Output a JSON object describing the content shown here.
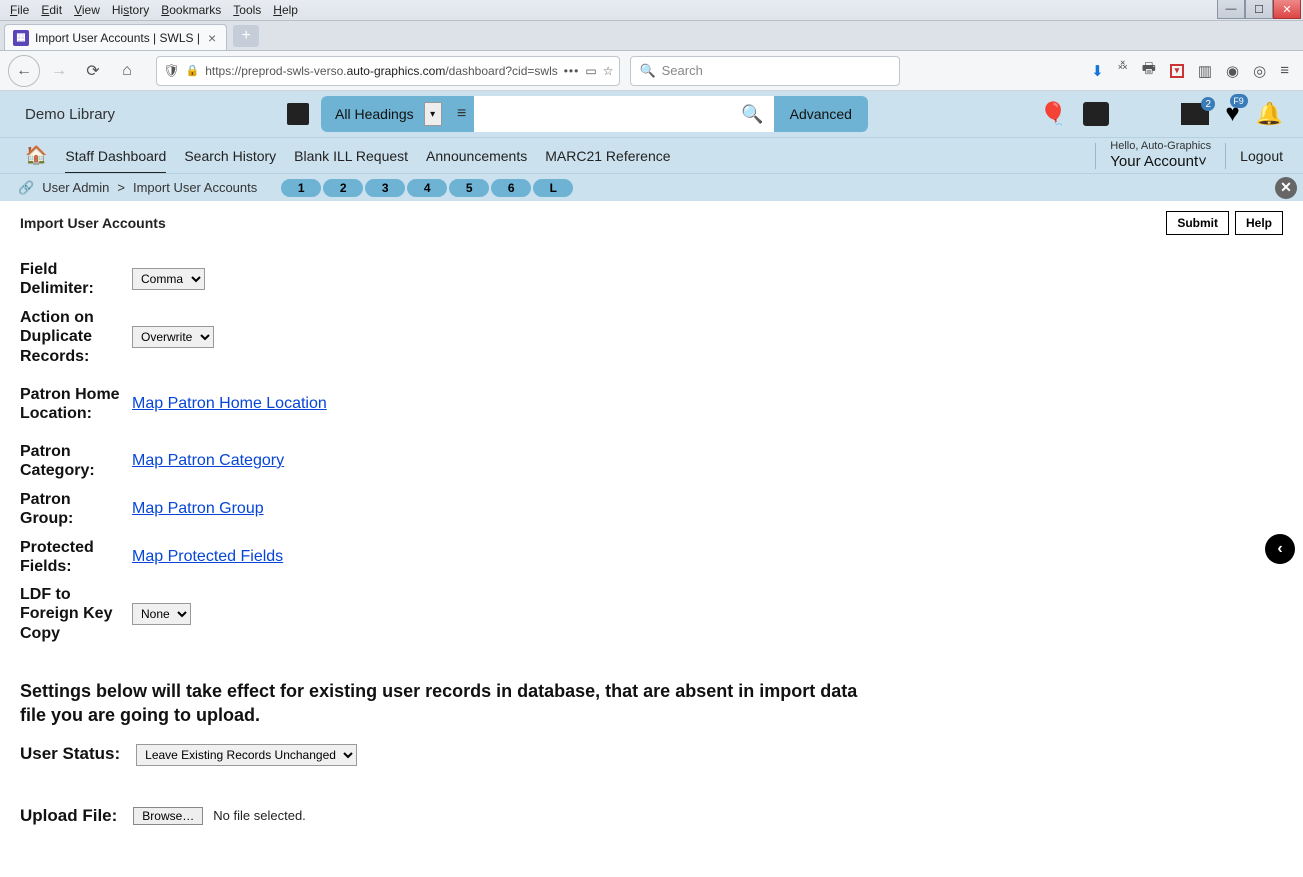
{
  "browser": {
    "menus": [
      "File",
      "Edit",
      "View",
      "History",
      "Bookmarks",
      "Tools",
      "Help"
    ],
    "tab_title": "Import User Accounts | SWLS | ",
    "url_prefix": "https://preprod-swls-verso.",
    "url_domain": "auto-graphics.com",
    "url_path": "/dashboard?cid=swls",
    "search_placeholder": "Search"
  },
  "app": {
    "library_name": "Demo Library",
    "search_type": "All Headings",
    "advanced_label": "Advanced",
    "badge_news": "2",
    "badge_heart": "F9",
    "nav": {
      "staff_dashboard": "Staff Dashboard",
      "search_history": "Search History",
      "blank_ill": "Blank ILL Request",
      "announcements": "Announcements",
      "marc21": "MARC21 Reference",
      "hello": "Hello, Auto-Graphics",
      "your_account": "Your Account",
      "logout": "Logout"
    },
    "breadcrumb": {
      "a": "User Admin",
      "sep": ">",
      "b": "Import User Accounts",
      "pages": [
        "1",
        "2",
        "3",
        "4",
        "5",
        "6",
        "L"
      ]
    }
  },
  "page": {
    "title": "Import User Accounts",
    "submit": "Submit",
    "help": "Help",
    "fields": {
      "field_delimiter_label": "Field Delimiter:",
      "field_delimiter_value": "Comma",
      "dup_action_label": "Action on Duplicate Records:",
      "dup_action_value": "Overwrite",
      "patron_home_label": "Patron Home Location:",
      "patron_home_link": "Map Patron Home Location",
      "patron_cat_label": "Patron Category:",
      "patron_cat_link": "Map Patron Category",
      "patron_group_label": "Patron Group:",
      "patron_group_link": "Map Patron Group",
      "protected_label": "Protected Fields:",
      "protected_link": "Map Protected Fields",
      "ldf_label": "LDF to Foreign Key Copy",
      "ldf_value": "None"
    },
    "note": "Settings below will take effect for existing user records in database, that are absent in import data file you are going to upload.",
    "user_status_label": "User Status:",
    "user_status_value": "Leave Existing Records Unchanged",
    "upload_label": "Upload File:",
    "browse_label": "Browse…",
    "no_file": "No file selected."
  }
}
